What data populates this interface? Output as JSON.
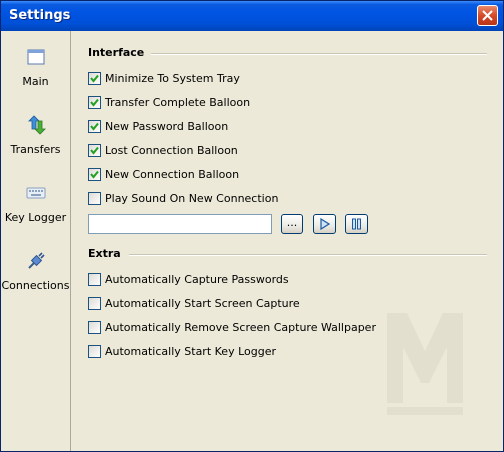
{
  "window": {
    "title": "Settings"
  },
  "sidebar": {
    "items": [
      {
        "label": "Main",
        "icon": "window-icon"
      },
      {
        "label": "Transfers",
        "icon": "transfer-arrows-icon"
      },
      {
        "label": "Key Logger",
        "icon": "keyboard-icon"
      },
      {
        "label": "Connections",
        "icon": "plug-icon"
      }
    ]
  },
  "interface": {
    "title": "Interface",
    "options": [
      {
        "label": "Minimize To System Tray",
        "checked": true
      },
      {
        "label": "Transfer Complete Balloon",
        "checked": true
      },
      {
        "label": "New Password Balloon",
        "checked": true
      },
      {
        "label": "Lost Connection Balloon",
        "checked": true
      },
      {
        "label": "New Connection Balloon",
        "checked": true
      },
      {
        "label": "Play Sound On New Connection",
        "checked": false
      }
    ],
    "sound_path": {
      "value": ""
    },
    "browse_label": "..."
  },
  "extra": {
    "title": "Extra",
    "options": [
      {
        "label": "Automatically Capture Passwords",
        "checked": false
      },
      {
        "label": "Automatically Start Screen Capture",
        "checked": false
      },
      {
        "label": "Automatically Remove Screen Capture Wallpaper",
        "checked": false
      },
      {
        "label": "Automatically Start Key Logger",
        "checked": false
      }
    ]
  },
  "colors": {
    "titlebar": "#0054e3",
    "face": "#ece9d8",
    "check": "#21a121"
  }
}
